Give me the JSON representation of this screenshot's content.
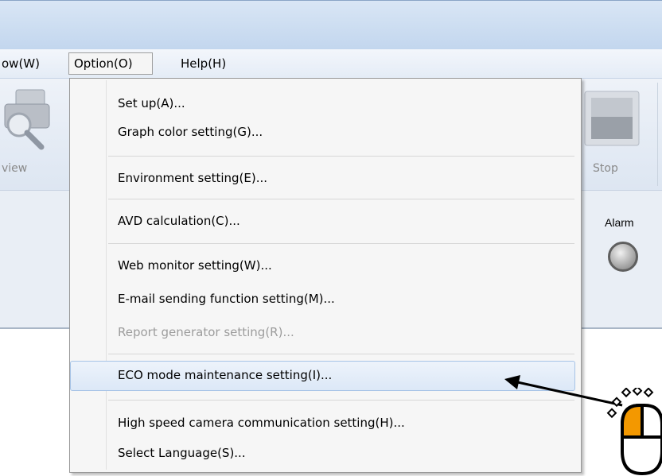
{
  "menubar": {
    "window_label": "ow(W)",
    "option_label": "Option(O)",
    "help_label": "Help(H)"
  },
  "toolbar": {
    "left_label": "view",
    "stop_label": "Stop"
  },
  "status": {
    "alarm_label": "Alarm"
  },
  "option_menu": {
    "items": [
      {
        "label": "Set up(A)...",
        "enabled": true
      },
      {
        "label": "Graph color setting(G)...",
        "enabled": true
      },
      {
        "label": "Environment setting(E)...",
        "enabled": true
      },
      {
        "label": "AVD calculation(C)...",
        "enabled": true
      },
      {
        "label": "Web monitor setting(W)...",
        "enabled": true
      },
      {
        "label": "E-mail sending function setting(M)...",
        "enabled": true
      },
      {
        "label": "Report generator setting(R)...",
        "enabled": false
      },
      {
        "label": "ECO mode maintenance setting(I)...",
        "enabled": true,
        "highlighted": true
      },
      {
        "label": "High speed camera communication setting(H)...",
        "enabled": true
      },
      {
        "label": "Select Language(S)...",
        "enabled": true
      }
    ]
  },
  "colors": {
    "highlight_border": "#a6c3e6",
    "accent_orange": "#f39800",
    "disabled_text": "#9c9c9c"
  },
  "icons": {
    "annotation": "arrow-icon",
    "pointer": "mouse-click-icon"
  }
}
